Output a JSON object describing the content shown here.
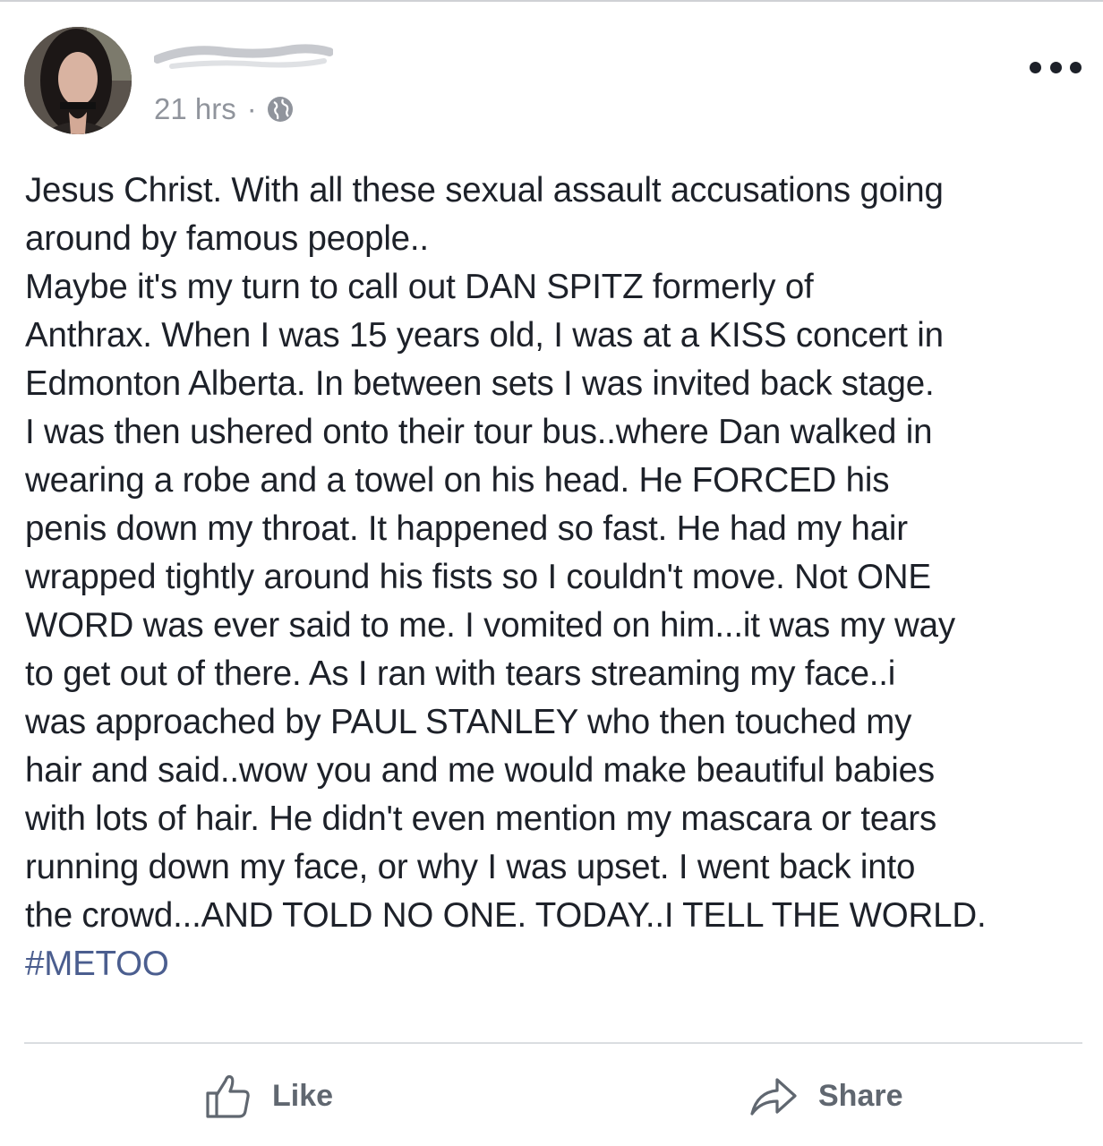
{
  "post": {
    "time": "21 hrs",
    "separator": "·",
    "privacy_icon": "globe-icon",
    "more_icon": "more-icon",
    "text_lines": [
      "Jesus Christ. With all these sexual assault accusations going",
      "around by famous people..",
      "Maybe it's my turn to call out DAN SPITZ formerly of",
      "Anthrax. When I was 15 years old, I was at a KISS concert in",
      "Edmonton Alberta. In between sets I was invited back stage.",
      "I was then ushered onto their tour bus..where Dan walked in",
      "wearing a robe and a towel on his head. He FORCED his",
      "penis down my throat. It happened so fast. He had my hair",
      "wrapped tightly around his fists so I couldn't move. Not ONE",
      "WORD was ever said to me. I vomited on him...it was my way",
      "to get out of there. As I ran with tears streaming my face..i",
      "was approached by PAUL STANLEY who then touched my",
      "hair and said..wow you and me would make beautiful babies",
      "with lots of hair. He didn't even mention my mascara or tears",
      "running down my face, or why I was upset. I went back into",
      "the crowd...AND TOLD NO ONE. TODAY..I TELL THE WORLD."
    ],
    "hashtag": "#METOO"
  },
  "actions": {
    "like_label": "Like",
    "like_icon": "thumbs-up-icon",
    "share_label": "Share",
    "share_icon": "share-arrow-icon"
  },
  "colors": {
    "text": "#1d2129",
    "meta": "#90949c",
    "hashtag": "#4b5e8f",
    "action": "#606770",
    "divider": "#dadde1"
  }
}
